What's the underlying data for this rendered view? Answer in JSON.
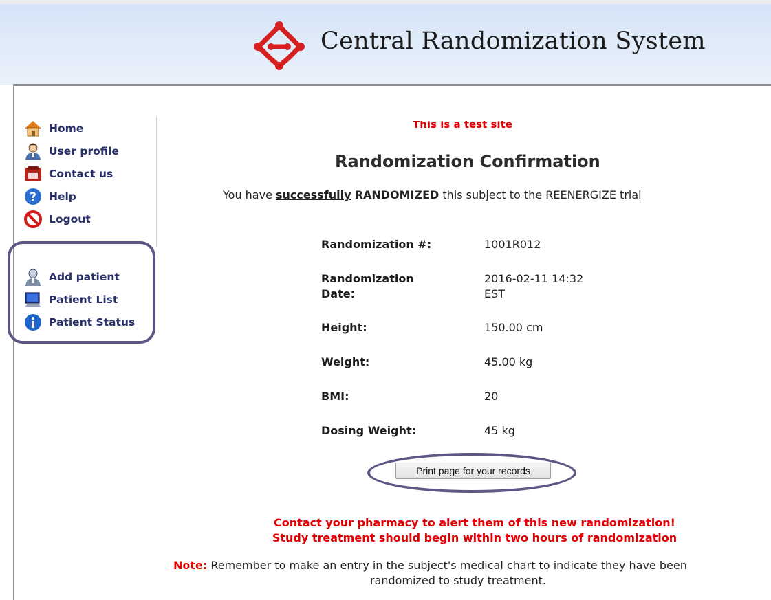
{
  "header": {
    "title": "Central Randomization System"
  },
  "nav": {
    "main": [
      {
        "label": "Home",
        "icon": "home-icon"
      },
      {
        "label": "User profile",
        "icon": "user-icon"
      },
      {
        "label": "Contact us",
        "icon": "phone-icon"
      },
      {
        "label": "Help",
        "icon": "help-icon"
      },
      {
        "label": "Logout",
        "icon": "logout-icon"
      }
    ],
    "patient": [
      {
        "label": "Add patient",
        "icon": "add-patient-icon"
      },
      {
        "label": "Patient List",
        "icon": "computer-icon"
      },
      {
        "label": "Patient Status",
        "icon": "info-icon"
      }
    ]
  },
  "main": {
    "test_site_notice": "This is a test site",
    "title": "Randomization Confirmation",
    "message": {
      "prefix": "You have ",
      "successfully": "successfully",
      "randomized": "RANDOMIZED",
      "suffix": " this subject to the REENERGIZE trial"
    },
    "details": [
      {
        "label": "Randomization #:",
        "value": "1001R012"
      },
      {
        "label": "Randomization Date:",
        "value": "2016-02-11 14:32 EST"
      },
      {
        "label": "Height:",
        "value": "150.00 cm"
      },
      {
        "label": "Weight:",
        "value": "45.00 kg"
      },
      {
        "label": "BMI:",
        "value": "20"
      },
      {
        "label": "Dosing Weight:",
        "value": "45 kg"
      }
    ],
    "print_button": "Print page for your records",
    "alert_line1": "Contact your pharmacy to alert them of this new randomization!",
    "alert_line2": "Study treatment should begin within two hours of randomization",
    "note_label": "Note:",
    "note_line1": " Remember to make an entry in the subject's medical chart to indicate they have been",
    "note_line2": "randomized to study treatment."
  },
  "colors": {
    "alert_red": "#e00000",
    "nav_text": "#28306a",
    "annotation_purple": "#5d5786",
    "logo_red": "#d62020"
  }
}
